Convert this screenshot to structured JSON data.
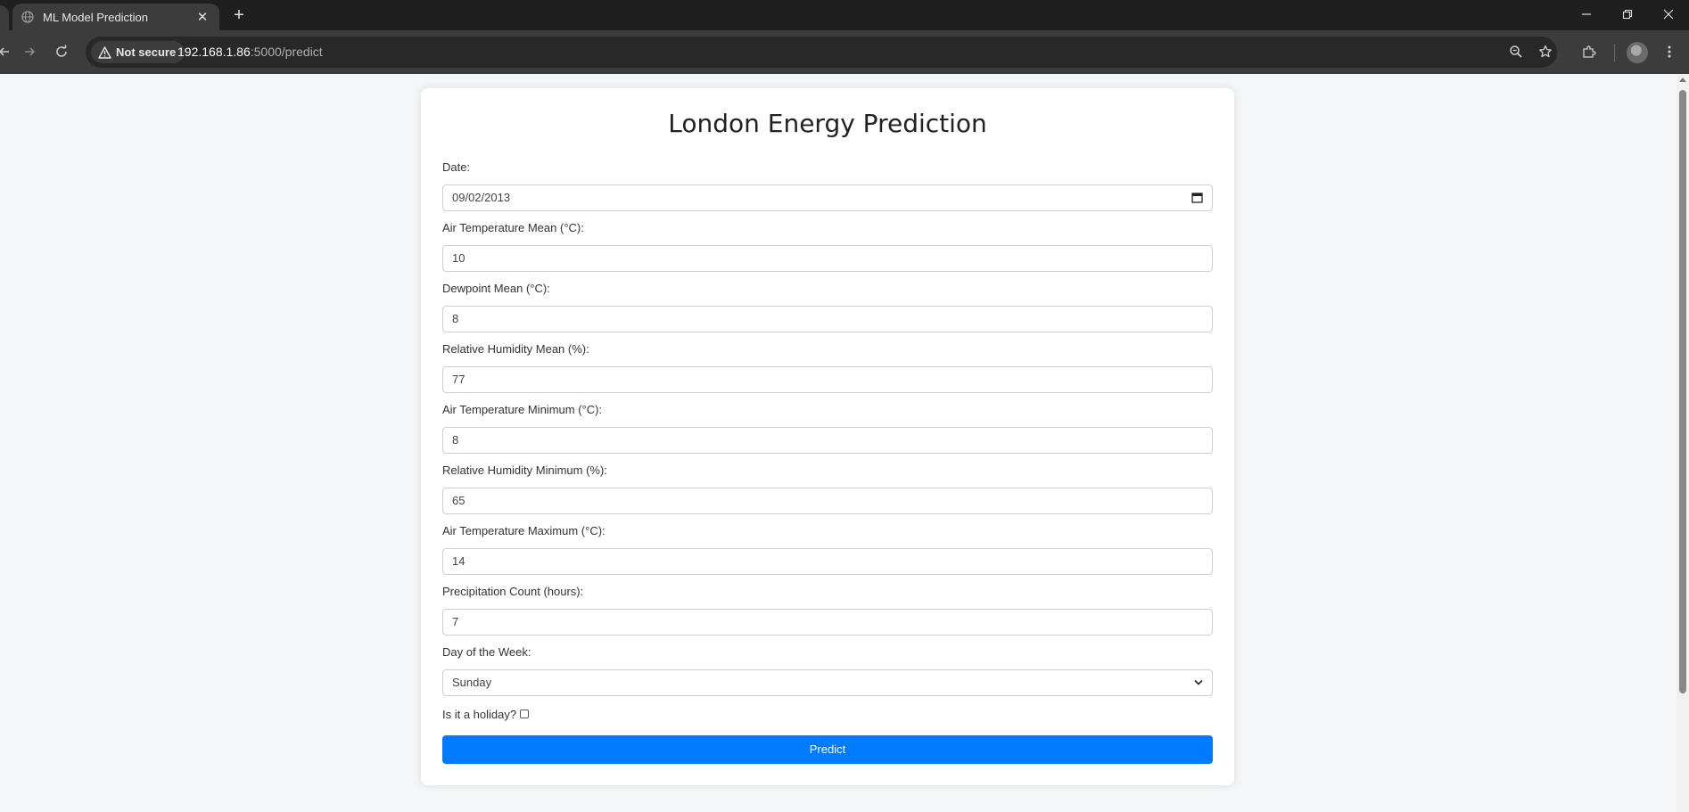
{
  "browser": {
    "tab_title": "ML Model Prediction",
    "tab_close": "✕",
    "new_tab": "+",
    "security_label": "Not secure",
    "url_host": "192.168.1.86",
    "url_path": ":5000/predict"
  },
  "page": {
    "title": "London Energy Prediction",
    "accent_color": "#007bff"
  },
  "form": {
    "date": {
      "label": "Date:",
      "value": "09/02/2013"
    },
    "air_temp_mean": {
      "label": "Air Temperature Mean (°C):",
      "value": "10"
    },
    "dewpoint_mean": {
      "label": "Dewpoint Mean (°C):",
      "value": "8"
    },
    "rel_humidity_mean": {
      "label": "Relative Humidity Mean (%):",
      "value": "77"
    },
    "air_temp_min": {
      "label": "Air Temperature Minimum (°C):",
      "value": "8"
    },
    "rel_humidity_min": {
      "label": "Relative Humidity Minimum (%):",
      "value": "65"
    },
    "air_temp_max": {
      "label": "Air Temperature Maximum (°C):",
      "value": "14"
    },
    "precipitation": {
      "label": "Precipitation Count (hours):",
      "value": "7"
    },
    "day_of_week": {
      "label": "Day of the Week:",
      "value": "Sunday"
    },
    "holiday": {
      "label": "Is it a holiday?",
      "checked": false
    },
    "submit_label": "Predict"
  }
}
